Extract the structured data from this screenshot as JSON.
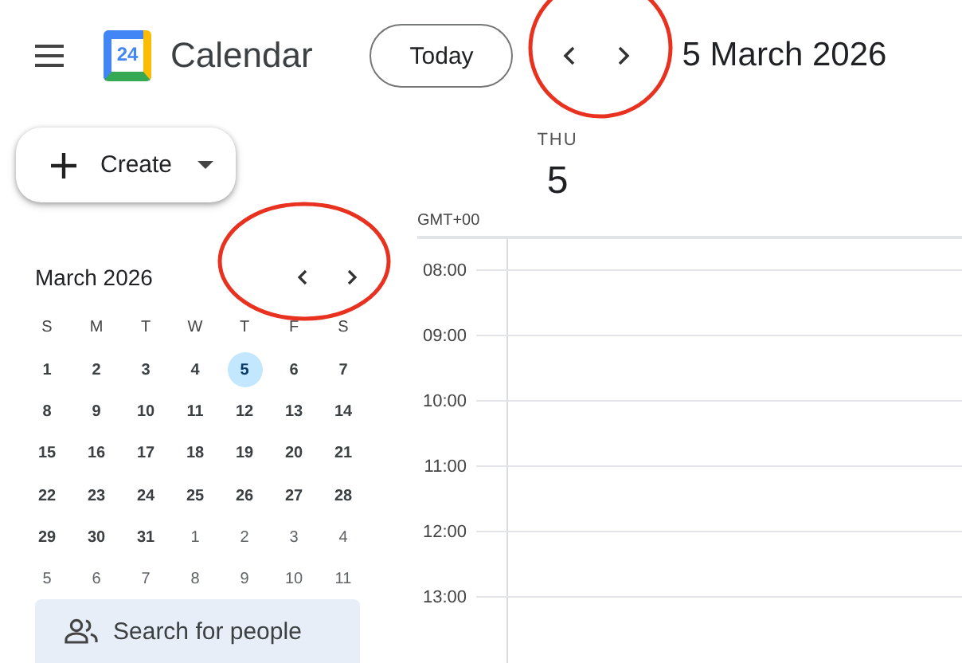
{
  "header": {
    "app_name": "Calendar",
    "logo_number": "24",
    "today_button": "Today",
    "date_title": "5 March 2026",
    "nav_circled": true
  },
  "create_button": {
    "label": "Create"
  },
  "mini_calendar": {
    "title": "March 2026",
    "nav_circled": true,
    "weekdays": [
      "S",
      "M",
      "T",
      "W",
      "T",
      "F",
      "S"
    ],
    "weeks": [
      [
        {
          "day": "1",
          "selected": false,
          "outside": false
        },
        {
          "day": "2",
          "selected": false,
          "outside": false
        },
        {
          "day": "3",
          "selected": false,
          "outside": false
        },
        {
          "day": "4",
          "selected": false,
          "outside": false
        },
        {
          "day": "5",
          "selected": true,
          "outside": false
        },
        {
          "day": "6",
          "selected": false,
          "outside": false
        },
        {
          "day": "7",
          "selected": false,
          "outside": false
        }
      ],
      [
        {
          "day": "8",
          "selected": false,
          "outside": false
        },
        {
          "day": "9",
          "selected": false,
          "outside": false
        },
        {
          "day": "10",
          "selected": false,
          "outside": false
        },
        {
          "day": "11",
          "selected": false,
          "outside": false
        },
        {
          "day": "12",
          "selected": false,
          "outside": false
        },
        {
          "day": "13",
          "selected": false,
          "outside": false
        },
        {
          "day": "14",
          "selected": false,
          "outside": false
        }
      ],
      [
        {
          "day": "15",
          "selected": false,
          "outside": false
        },
        {
          "day": "16",
          "selected": false,
          "outside": false
        },
        {
          "day": "17",
          "selected": false,
          "outside": false
        },
        {
          "day": "18",
          "selected": false,
          "outside": false
        },
        {
          "day": "19",
          "selected": false,
          "outside": false
        },
        {
          "day": "20",
          "selected": false,
          "outside": false
        },
        {
          "day": "21",
          "selected": false,
          "outside": false
        }
      ],
      [
        {
          "day": "22",
          "selected": false,
          "outside": false
        },
        {
          "day": "23",
          "selected": false,
          "outside": false
        },
        {
          "day": "24",
          "selected": false,
          "outside": false
        },
        {
          "day": "25",
          "selected": false,
          "outside": false
        },
        {
          "day": "26",
          "selected": false,
          "outside": false
        },
        {
          "day": "27",
          "selected": false,
          "outside": false
        },
        {
          "day": "28",
          "selected": false,
          "outside": false
        }
      ],
      [
        {
          "day": "29",
          "selected": false,
          "outside": false
        },
        {
          "day": "30",
          "selected": false,
          "outside": false
        },
        {
          "day": "31",
          "selected": false,
          "outside": false
        },
        {
          "day": "1",
          "selected": false,
          "outside": true
        },
        {
          "day": "2",
          "selected": false,
          "outside": true
        },
        {
          "day": "3",
          "selected": false,
          "outside": true
        },
        {
          "day": "4",
          "selected": false,
          "outside": true
        }
      ],
      [
        {
          "day": "5",
          "selected": false,
          "outside": true
        },
        {
          "day": "6",
          "selected": false,
          "outside": true
        },
        {
          "day": "7",
          "selected": false,
          "outside": true
        },
        {
          "day": "8",
          "selected": false,
          "outside": true
        },
        {
          "day": "9",
          "selected": false,
          "outside": true
        },
        {
          "day": "10",
          "selected": false,
          "outside": true
        },
        {
          "day": "11",
          "selected": false,
          "outside": true
        }
      ]
    ]
  },
  "people_search": {
    "placeholder": "Search for people"
  },
  "day_view": {
    "weekday": "THU",
    "day": "5",
    "timezone": "GMT+00",
    "hours": [
      "08:00",
      "09:00",
      "10:00",
      "11:00",
      "12:00",
      "13:00"
    ]
  }
}
